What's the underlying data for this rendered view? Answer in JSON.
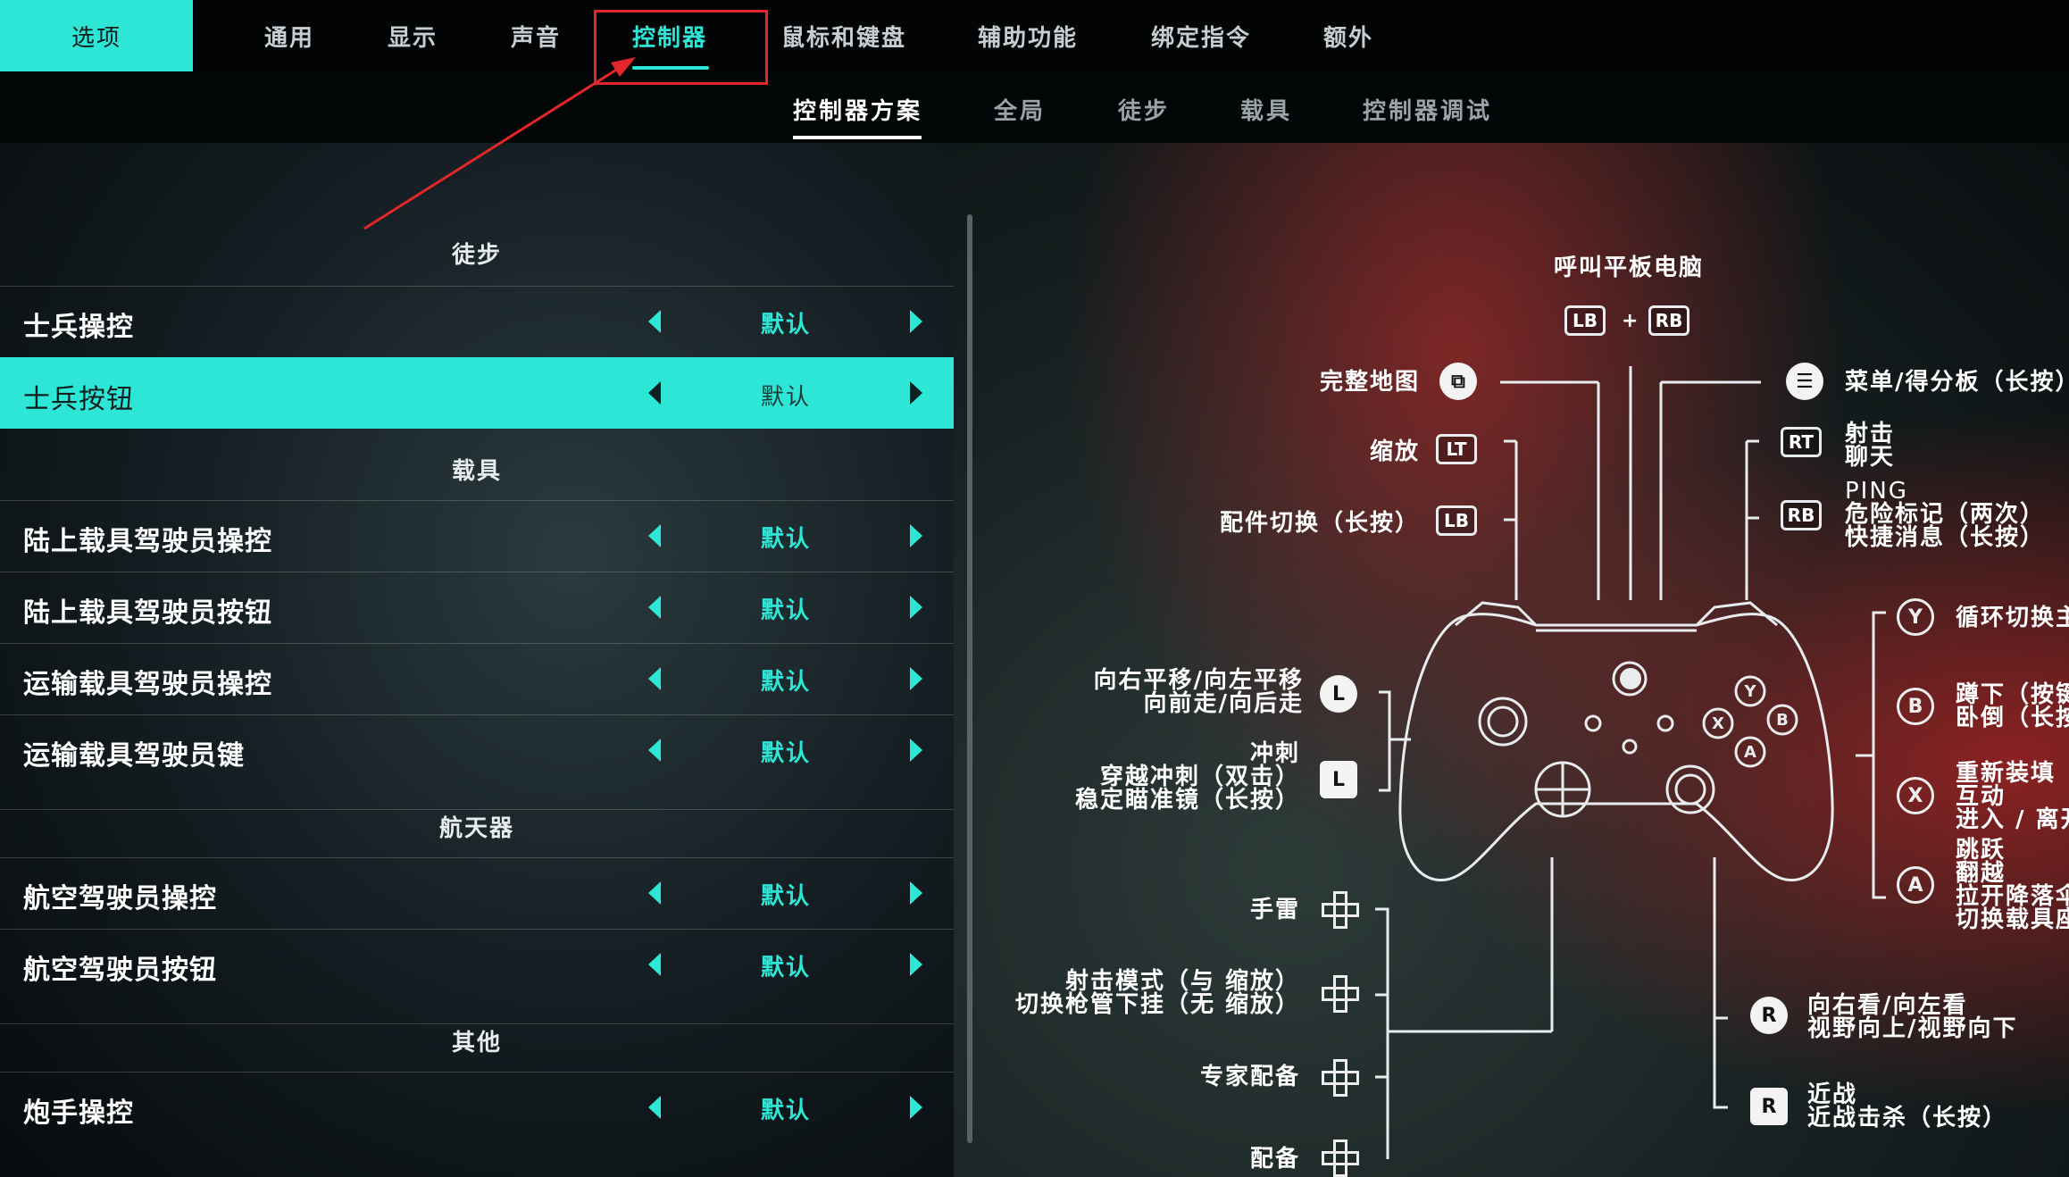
{
  "nav": {
    "options": "选项",
    "tabs": [
      "通用",
      "显示",
      "声音",
      "控制器",
      "鼠标和键盘",
      "辅助功能",
      "绑定指令",
      "额外"
    ],
    "active_tab": "控制器"
  },
  "subnav": {
    "tabs": [
      "控制器方案",
      "全局",
      "徒步",
      "载具",
      "控制器调试"
    ],
    "active": "控制器方案"
  },
  "list": {
    "sections": [
      {
        "header": "徒步",
        "rows": [
          {
            "label": "士兵操控",
            "value": "默认"
          },
          {
            "label": "士兵按钮",
            "value": "默认",
            "selected": true
          }
        ]
      },
      {
        "header": "载具",
        "rows": [
          {
            "label": "陆上载具驾驶员操控",
            "value": "默认"
          },
          {
            "label": "陆上载具驾驶员按钮",
            "value": "默认"
          },
          {
            "label": "运输载具驾驶员操控",
            "value": "默认"
          },
          {
            "label": "运输载具驾驶员键",
            "value": "默认"
          }
        ]
      },
      {
        "header": "航天器",
        "rows": [
          {
            "label": "航空驾驶员操控",
            "value": "默认"
          },
          {
            "label": "航空驾驶员按钮",
            "value": "默认"
          }
        ]
      },
      {
        "header": "其他",
        "rows": [
          {
            "label": "炮手操控",
            "value": "默认"
          }
        ]
      }
    ]
  },
  "mapping": {
    "tablet": "呼叫平板电脑",
    "lb": "LB",
    "rb": "RB",
    "plus": "+",
    "lt": "LT",
    "rt": "RT",
    "full_map": "完整地图",
    "zoom": "缩放",
    "attachment": "配件切换（长按）",
    "menu": "菜单/得分板（长按）",
    "rt_line1": "射击",
    "rt_line2": "聊天",
    "rb_line1": "PING",
    "rb_line2": "危险标记（两次）",
    "rb_line3": "快捷消息（长按）",
    "y_label": "循环切换主",
    "b_line1": "蹲下（按键",
    "b_line2": "卧倒（长按",
    "x_line1": "重新装填",
    "x_line2": "互动",
    "x_line3": "进入 / 离开",
    "a_line1": "跳跃",
    "a_line2": "翻越",
    "a_line3": "拉开降落伞",
    "a_line4": "切换载具座",
    "ls_line1": "向右平移/向左平移",
    "ls_line2": "向前走/向后走",
    "l_key": "L",
    "r_key": "R",
    "sprint_line1": "冲刺",
    "sprint_line2": "穿越冲刺（双击）",
    "sprint_line3": "稳定瞄准镜（长按）",
    "grenade": "手雷",
    "fire_mode_line1": "射击模式（与 缩放）",
    "fire_mode_line2": "切换枪管下挂（无 缩放）",
    "specialist": "专家配备",
    "gadget": "配备",
    "rs_line1": "向右看/向左看",
    "rs_line2": "视野向上/视野向下",
    "melee_line1": "近战",
    "melee_line2": "近战击杀（长按）",
    "face": {
      "y": "Y",
      "b": "B",
      "x": "X",
      "a": "A"
    }
  },
  "colors": {
    "accent": "#2ee6d6",
    "annotation": "#e3262a"
  }
}
